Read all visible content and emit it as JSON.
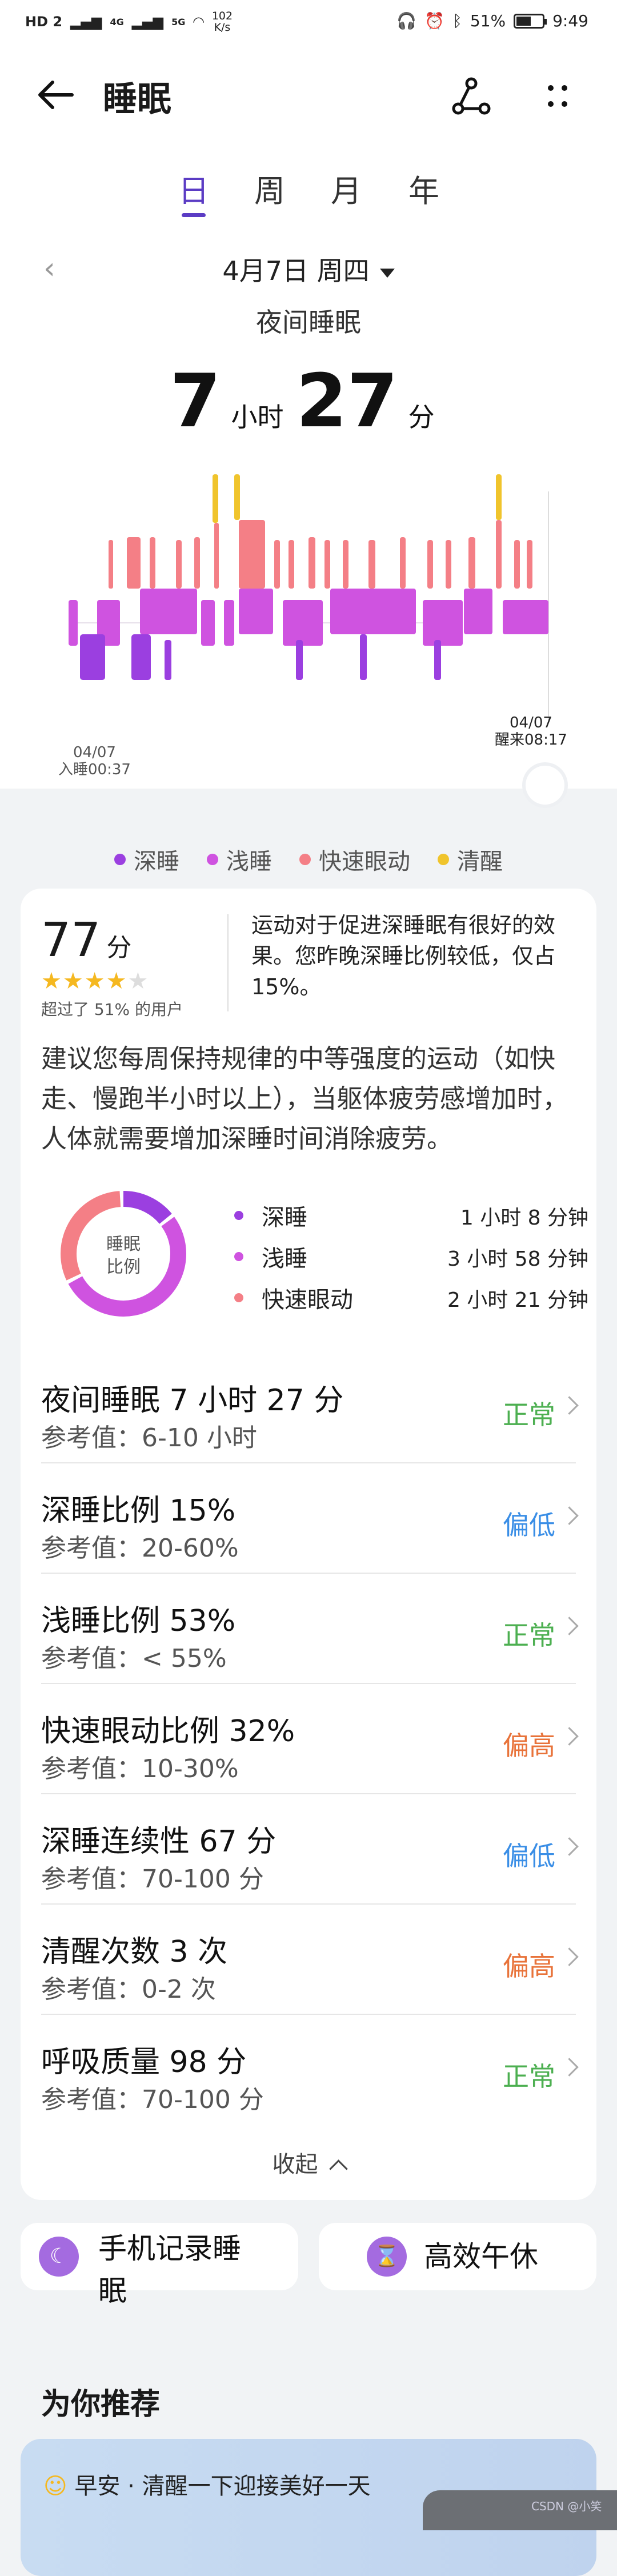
{
  "status_bar": {
    "network_left": "HD 2",
    "signal_1": "4G",
    "signal_2": "5G",
    "speed_value": "102",
    "speed_unit": "K/s",
    "battery": "51%",
    "time": "9:49"
  },
  "header": {
    "title": "睡眠"
  },
  "tabs": [
    "日",
    "周",
    "月",
    "年"
  ],
  "active_tab": 0,
  "date": "4月7日 周四",
  "subtitle": "夜间睡眠",
  "duration": {
    "hours": "7",
    "hours_unit": "小时",
    "minutes": "27",
    "minutes_unit": "分"
  },
  "chart_labels": {
    "start_date": "04/07",
    "start_text": "入睡00:37",
    "end_date": "04/07",
    "end_text": "醒来08:17"
  },
  "colors": {
    "deep": "#9b3fe0",
    "light": "#cf53e0",
    "rem": "#f47f86",
    "awake": "#f0c42c",
    "accent": "#5b3cc4"
  },
  "legend": [
    {
      "label": "深睡",
      "color": "#9b3fe0"
    },
    {
      "label": "浅睡",
      "color": "#cf53e0"
    },
    {
      "label": "快速眼动",
      "color": "#f47f86"
    },
    {
      "label": "清醒",
      "color": "#f0c42c"
    }
  ],
  "score": {
    "value": "77",
    "unit": "分",
    "stars": 4,
    "max_stars": 5,
    "beat": "超过了 51% 的用户"
  },
  "advice_short": "运动对于促进深睡眠有很好的效果。您昨晚深睡比例较低，仅占15%。",
  "advice_long": "建议您每周保持规律的中等强度的运动（如快走、慢跑半小时以上），当躯体疲劳感增加时，人体就需要增加深睡时间消除疲劳。",
  "donut": {
    "label_line1": "睡眠",
    "label_line2": "比例",
    "stages": [
      {
        "name": "深睡",
        "value": "1 小时 8 分钟",
        "percent": 15,
        "color": "#9b3fe0"
      },
      {
        "name": "浅睡",
        "value": "3 小时 58 分钟",
        "percent": 53,
        "color": "#cf53e0"
      },
      {
        "name": "快速眼动",
        "value": "2 小时 21 分钟",
        "percent": 32,
        "color": "#f47f86"
      }
    ]
  },
  "metrics": [
    {
      "name": "夜间睡眠  7 小时 27 分",
      "ref": "参考值：6-10 小时",
      "status": "正常",
      "color": "#4caf50"
    },
    {
      "name": "深睡比例  15%",
      "ref": "参考值：20-60%",
      "status": "偏低",
      "color": "#3a8ee6"
    },
    {
      "name": "浅睡比例  53%",
      "ref": "参考值：< 55%",
      "status": "正常",
      "color": "#4caf50"
    },
    {
      "name": "快速眼动比例  32%",
      "ref": "参考值：10-30%",
      "status": "偏高",
      "color": "#e8733a"
    },
    {
      "name": "深睡连续性  67 分",
      "ref": "参考值：70-100 分",
      "status": "偏低",
      "color": "#3a8ee6"
    },
    {
      "name": "清醒次数  3 次",
      "ref": "参考值：0-2 次",
      "status": "偏高",
      "color": "#e8733a"
    },
    {
      "name": "呼吸质量  98 分",
      "ref": "参考值：70-100 分",
      "status": "正常",
      "color": "#4caf50"
    }
  ],
  "collapse_label": "收起",
  "buttons": {
    "record_line1": "手机记录睡",
    "record_line2": "眠",
    "nap": "高效午休"
  },
  "recommend": {
    "title": "为你推荐",
    "card_text": "早安 · 清醒一下迎接美好一天"
  },
  "watermark": "CSDN @小笑"
}
